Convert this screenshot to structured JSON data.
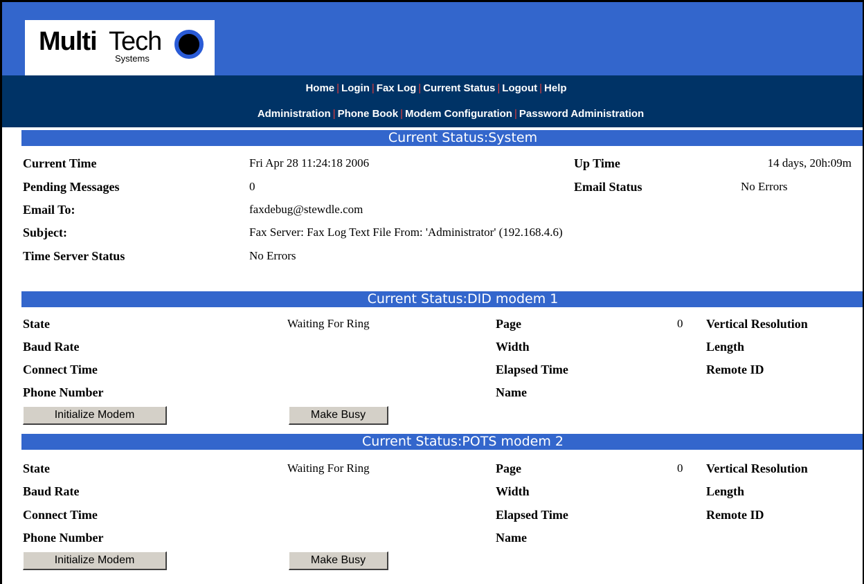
{
  "logo": {
    "multi": "Multi",
    "tech": "Tech",
    "systems": "Systems"
  },
  "nav": {
    "row1": [
      "Home",
      "Login",
      "Fax Log",
      "Current Status",
      "Logout",
      "Help"
    ],
    "row2": [
      "Administration",
      "Phone Book",
      "Modem Configuration",
      "Password Administration"
    ]
  },
  "system": {
    "title": "Current Status:System",
    "current_time_label": "Current Time",
    "current_time": "Fri Apr 28 11:24:18 2006",
    "up_time_label": "Up Time",
    "up_time": "14 days, 20h:09m",
    "pending_label": "Pending Messages",
    "pending": "0",
    "email_status_label": "Email Status",
    "email_status": "No Errors",
    "email_to_label": "Email To:",
    "email_to": "faxdebug@stewdle.com",
    "subject_label": "Subject:",
    "subject": "Fax Server: Fax Log Text File From: 'Administrator' (192.168.4.6)",
    "time_server_label": "Time Server Status",
    "time_server": "No Errors"
  },
  "modems": [
    {
      "title": "Current Status:DID modem 1",
      "state_label": "State",
      "state": "Waiting For Ring",
      "page_label": "Page",
      "page": "0",
      "vres_label": "Vertical Resolution",
      "baud_label": "Baud Rate",
      "width_label": "Width",
      "length_label": "Length",
      "connect_label": "Connect Time",
      "elapsed_label": "Elapsed Time",
      "remote_label": "Remote ID",
      "phone_label": "Phone Number",
      "name_label": "Name",
      "init_button": "Initialize Modem",
      "busy_button": "Make Busy"
    },
    {
      "title": "Current Status:POTS modem 2",
      "state_label": "State",
      "state": "Waiting For Ring",
      "page_label": "Page",
      "page": "0",
      "vres_label": "Vertical Resolution",
      "baud_label": "Baud Rate",
      "width_label": "Width",
      "length_label": "Length",
      "connect_label": "Connect Time",
      "elapsed_label": "Elapsed Time",
      "remote_label": "Remote ID",
      "phone_label": "Phone Number",
      "name_label": "Name",
      "init_button": "Initialize Modem",
      "busy_button": "Make Busy"
    }
  ],
  "colors": {
    "header_blue": "#3366cc",
    "nav_navy": "#003366",
    "separator_red": "#e03c3c"
  }
}
